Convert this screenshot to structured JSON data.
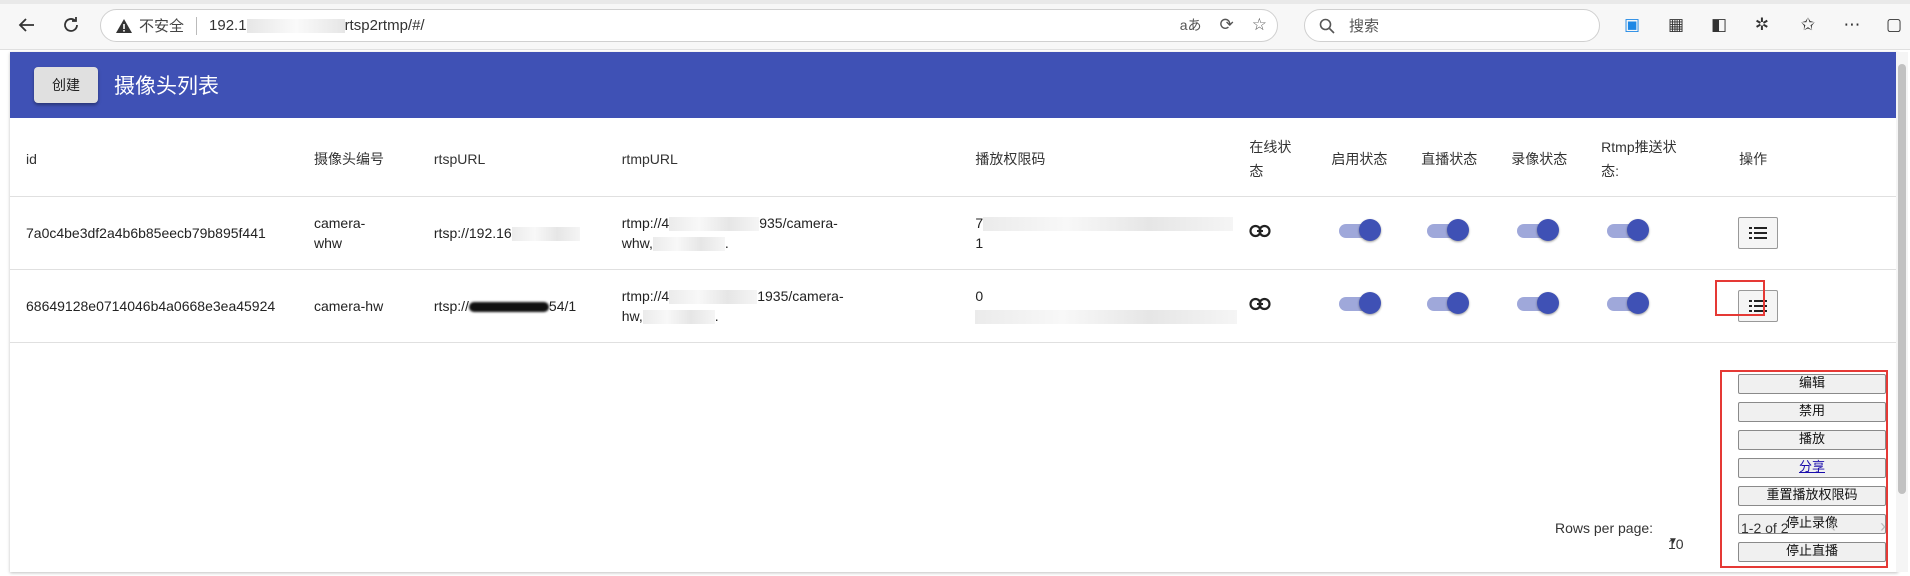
{
  "browser": {
    "insecure_label": "不安全",
    "url_prefix": "192.1",
    "url_suffix": "rtsp2rtmp/#/",
    "search_placeholder": "搜索"
  },
  "header": {
    "create_label": "创建",
    "title": "摄像头列表"
  },
  "table": {
    "columns": [
      "id",
      "摄像头编号",
      "rtspURL",
      "rtmpURL",
      "播放权限码",
      "在线状态",
      "启用状态",
      "直播状态",
      "录像状态",
      "Rtmp推送状态:",
      "操作"
    ],
    "rows": [
      {
        "id": "7a0c4be3df2a4b6b85eecb79b895f441",
        "code": "camera-whw",
        "rtsp": "rtsp://192.16",
        "rtmp_line1_a": "rtmp://4",
        "rtmp_line1_b": "935/camera-",
        "rtmp_line2_a": "whw,",
        "rtmp_line2_b": ".",
        "auth_a": "7",
        "auth_b": "1",
        "enabled": true,
        "live": true,
        "record": true,
        "rtmp_push": true
      },
      {
        "id": "68649128e0714046b4a0668e3ea45924",
        "code": "camera-hw",
        "rtsp_a": "rtsp://",
        "rtsp_b": "54/1",
        "rtmp_line1_a": "rtmp://4",
        "rtmp_line1_b": "1935/camera-",
        "rtmp_line2_a": "hw,",
        "rtmp_line2_b": ".",
        "auth_a": "0",
        "enabled": true,
        "live": true,
        "record": true,
        "rtmp_push": true
      }
    ]
  },
  "actions_menu": [
    "编辑",
    "禁用",
    "播放",
    "分享",
    "重置播放权限码",
    "停止录像",
    "停止直播"
  ],
  "pagination": {
    "rows_per_page_label": "Rows per page:",
    "rows_per_page_value": "10",
    "range_text": "1-2 of 2"
  },
  "colors": {
    "primary": "#3f51b5",
    "toggle_track": "#9fa8da",
    "highlight": "#e53935"
  }
}
